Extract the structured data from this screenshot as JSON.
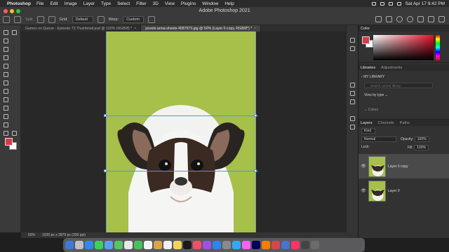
{
  "menubar": {
    "app_name": "Photoshop",
    "items": [
      "File",
      "Edit",
      "Image",
      "Layer",
      "Type",
      "Select",
      "Filter",
      "3D",
      "View",
      "Plugins",
      "Window",
      "Help"
    ],
    "clock": "Sat Apr 17  9:42 PM"
  },
  "window": {
    "title": "Adobe Photoshop 2021"
  },
  "options": {
    "split_label": "Split",
    "grid_label": "Grid:",
    "grid_value": "Default",
    "warp_label": "Warp:",
    "warp_value": "Custom"
  },
  "tabs": [
    {
      "label": "Games on Queue - Episode 73 Thumbnail.psd @ 100% (RGB/8) *",
      "close": "×"
    },
    {
      "label": "pexels-anna-shvets-4587973.jpg @ 50% (Layer 0 copy, RGB/8*) *",
      "close": "×"
    }
  ],
  "status": {
    "zoom": "50%",
    "size": "1920 px x 2879 px (300 ppi)"
  },
  "panels": {
    "color_tab": "Color",
    "libraries_tab": "Libraries",
    "adjustments_tab": "Adjustments",
    "my_library": "MY LIBRARY",
    "search_placeholder": "Search current library",
    "view_by": "View by type",
    "colors_group": "Colors",
    "layers_tab": "Layers",
    "channels_tab": "Channels",
    "paths_tab": "Paths",
    "kind_label": "Kind",
    "blend_mode": "Normal",
    "opacity_label": "Opacity:",
    "opacity_value": "100%",
    "fill_label": "Fill:",
    "fill_value": "100%",
    "lock_label": "Lock:"
  },
  "layers": [
    {
      "name": "Layer 0 copy",
      "selected": true,
      "eye": "👁"
    },
    {
      "name": "Layer 0",
      "selected": false,
      "eye": "👁"
    }
  ],
  "colors": {
    "foreground": "#d93a48",
    "background": "#ffffff",
    "canvas_green": "#a6c04a",
    "guide_blue": "#5b8fe0"
  }
}
